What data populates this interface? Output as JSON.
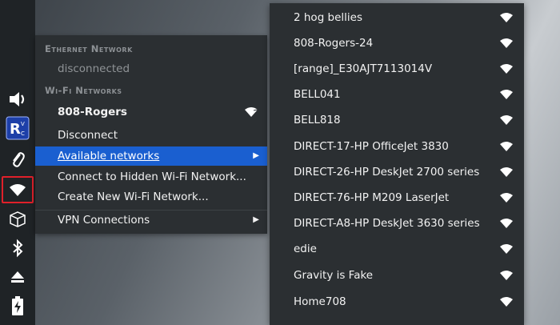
{
  "main_menu": {
    "ethernet_header": "Ethernet Network",
    "ethernet_status": "disconnected",
    "wifi_header": "Wi-Fi Networks",
    "connected_network": "808-Rogers",
    "disconnect": "Disconnect",
    "available_networks": "Available networks",
    "connect_hidden": "Connect to Hidden Wi-Fi Network...",
    "create_new": "Create New Wi-Fi Network...",
    "vpn": "VPN Connections"
  },
  "networks": [
    "2 hog bellies",
    "808-Rogers-24",
    "[range]_E30AJT7113014V",
    "BELL041",
    "BELL818",
    "DIRECT-17-HP OfficeJet 3830",
    "DIRECT-26-HP DeskJet 2700 series",
    "DIRECT-76-HP M209 LaserJet",
    "DIRECT-A8-HP DeskJet 3630 series",
    "edie",
    "Gravity is Fake",
    "Home708"
  ],
  "panel_icons": [
    "volume-icon",
    "app-logo-icon",
    "paperclip-icon",
    "wifi-icon",
    "package-icon",
    "bluetooth-icon",
    "eject-icon",
    "battery-charging-icon"
  ],
  "colors": {
    "menu_bg": "#2b2f32",
    "highlight": "#1a5fd0",
    "panel_bg": "#1f2326",
    "selection_border": "#e0202a"
  }
}
